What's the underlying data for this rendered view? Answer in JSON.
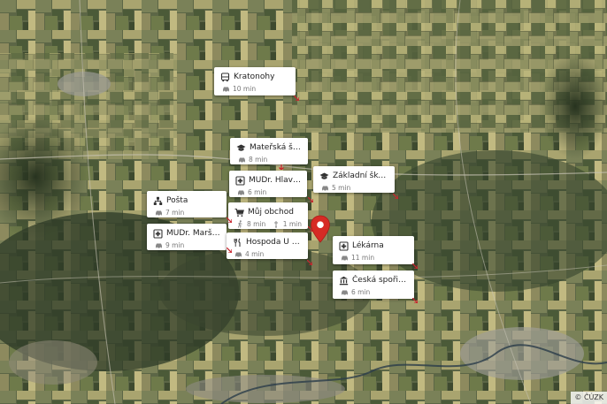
{
  "map": {
    "copyright": "© ČÚZK"
  },
  "places": [
    {
      "id": "kratonohy",
      "name": "Kratonohy",
      "icon": "bus-icon",
      "mode": "car-icon",
      "time": "10 min"
    },
    {
      "id": "materska",
      "name": "Mateřská škola R...",
      "icon": "school-icon",
      "mode": "car-icon",
      "time": "8 min"
    },
    {
      "id": "zakladni",
      "name": "Základní škola Ro...",
      "icon": "school-icon",
      "mode": "car-icon",
      "time": "5 min"
    },
    {
      "id": "hlavackova",
      "name": "MUDr. Hlaváčkov...",
      "icon": "medical-cross-icon",
      "mode": "car-icon",
      "time": "6 min"
    },
    {
      "id": "posta",
      "name": "Pošta",
      "icon": "post-office-icon",
      "mode": "car-icon",
      "time": "7 min"
    },
    {
      "id": "obchod",
      "name": "Můj obchod",
      "icon": "shopping-cart-icon",
      "mode": "walk-icon",
      "time": "8 min",
      "mode2": "bike-icon",
      "time2": "1 min"
    },
    {
      "id": "marsalek",
      "name": "MUDr. Maršálek ...",
      "icon": "medical-cross-icon",
      "mode": "car-icon",
      "time": "9 min"
    },
    {
      "id": "hospoda",
      "name": "Hospoda U Václava",
      "icon": "restaurant-icon",
      "mode": "car-icon",
      "time": "4 min"
    },
    {
      "id": "lekarna",
      "name": "Lékárna",
      "icon": "medical-cross-icon",
      "mode": "car-icon",
      "time": "11 min"
    },
    {
      "id": "sporitelna",
      "name": "Česká spořitelna",
      "icon": "bank-icon",
      "mode": "car-icon",
      "time": "6 min"
    }
  ],
  "colors": {
    "pin": "#d62b25",
    "pointer": "#c6262e",
    "card": "#ffffff"
  }
}
